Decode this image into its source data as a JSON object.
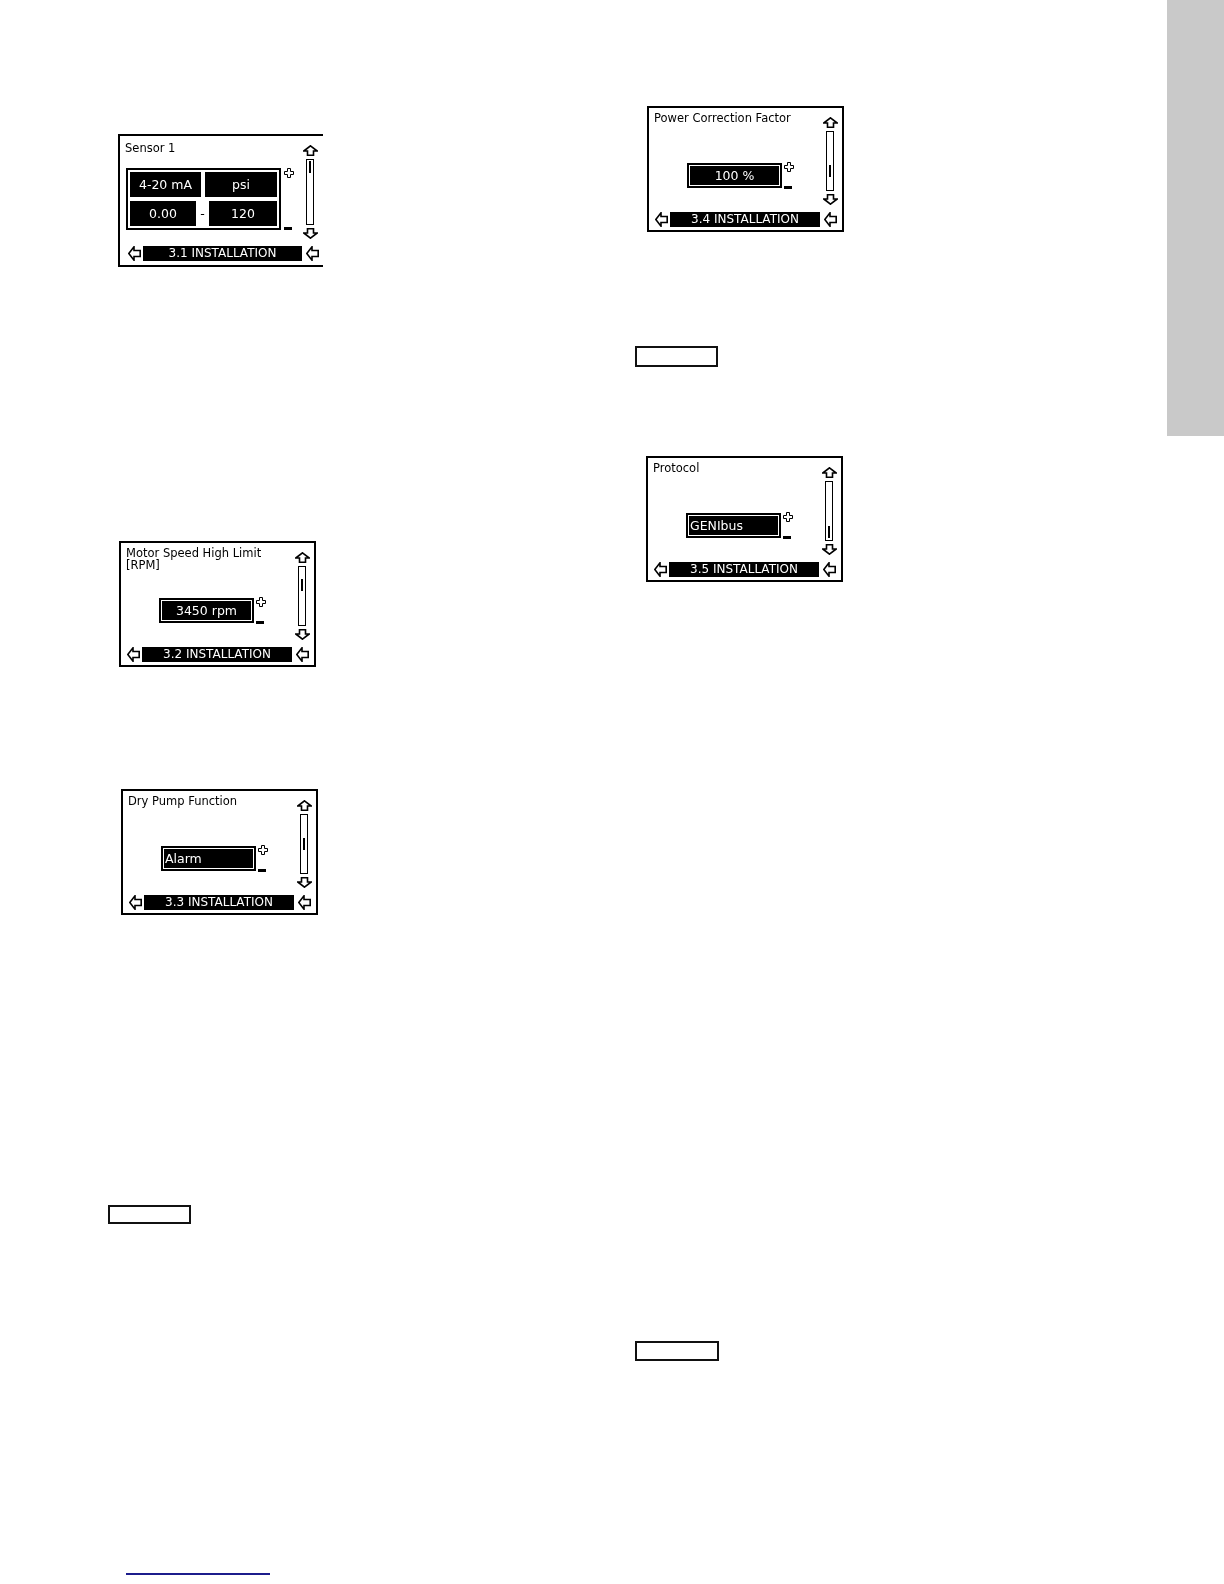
{
  "screens": [
    {
      "kind": "range",
      "title": "Sensor 1",
      "signal": "4-20 mA",
      "unit": "psi",
      "min": "0.00",
      "separator": "-",
      "max": "120",
      "menu": "3.1 INSTALLATION"
    },
    {
      "kind": "number",
      "title": "Motor Speed High Limit [RPM]",
      "value": "3450 rpm",
      "menu": "3.2 INSTALLATION"
    },
    {
      "kind": "choice",
      "title": "Dry Pump Function",
      "value": "Alarm",
      "menu": "3.3 INSTALLATION"
    },
    {
      "kind": "number",
      "title": "Power Correction Factor",
      "value": "100 %",
      "menu": "3.4 INSTALLATION"
    },
    {
      "kind": "choice",
      "title": "Protocol",
      "value": "GENIbus",
      "menu": "3.5 INSTALLATION"
    }
  ]
}
